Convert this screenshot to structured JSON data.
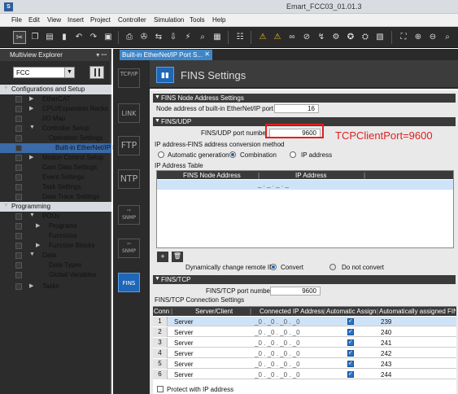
{
  "window": {
    "title": "Emart_FCC03_01.01.3"
  },
  "menu": [
    "File",
    "Edit",
    "View",
    "Insert",
    "Project",
    "Controller",
    "Simulation",
    "Tools",
    "Help"
  ],
  "sidebar": {
    "title": "Multiview Explorer",
    "pin": "▾ ꟷ",
    "device": "FCC",
    "items": [
      {
        "label": "Configurations and Setup",
        "toggle": "▼",
        "head": true
      },
      {
        "label": "EtherCAT",
        "toggle": "▶"
      },
      {
        "label": "CPU/Expansion Racks",
        "toggle": "▶"
      },
      {
        "label": "I/O Map",
        "toggle": ""
      },
      {
        "label": "Controller Setup",
        "toggle": "▼"
      },
      {
        "label": "Operation Settings",
        "toggle": ""
      },
      {
        "label": "Built-in EtherNet/IP P",
        "toggle": "",
        "selected": true
      },
      {
        "label": "Motion Control Setup",
        "toggle": "▶"
      },
      {
        "label": "Cam Data Settings",
        "toggle": ""
      },
      {
        "label": "Event Settings",
        "toggle": ""
      },
      {
        "label": "Task Settings",
        "toggle": ""
      },
      {
        "label": "Data Trace Settings",
        "toggle": ""
      },
      {
        "label": "Programming",
        "toggle": "▼",
        "head": true
      },
      {
        "label": "POUs",
        "toggle": "▼"
      },
      {
        "label": "Programs",
        "toggle": "▶"
      },
      {
        "label": "Functions",
        "toggle": ""
      },
      {
        "label": "Function Blocks",
        "toggle": "▶"
      },
      {
        "label": "Data",
        "toggle": "▼"
      },
      {
        "label": "Data Types",
        "toggle": ""
      },
      {
        "label": "Global Variables",
        "toggle": ""
      },
      {
        "label": "Tasks",
        "toggle": "▶"
      }
    ]
  },
  "tab": {
    "label": "Built-in EtherNet/IP Port S...",
    "close": "✕"
  },
  "protocols": [
    "TCP/IP",
    "LINK",
    "FTP",
    "NTP",
    "SNMP",
    "SNMP",
    "FINS"
  ],
  "content": {
    "heading": "FINS Settings",
    "fins_node": {
      "section": "FINS Node Address Settings",
      "node_label": "Node address of built-in EtherNet/IP port",
      "node_value": "16"
    },
    "fins_udp": {
      "section": "FINS/UDP",
      "port_label": "FINS/UDP port numbe",
      "port_value": "9600",
      "method_label": "IP address-FINS address conversion method",
      "options": [
        "Automatic generation",
        "Combination",
        "IP address"
      ],
      "selected_option": "Combination",
      "table_label": "IP Address Table",
      "table_headers": [
        "FINS Node Address",
        "IP Address"
      ],
      "table_row_ip": "_ . _ . _ . _",
      "add_button": "+",
      "delete_button": "🗑",
      "dyn_label": "Dynamically change remote IP",
      "dyn_options": [
        "Convert",
        "Do not convert"
      ],
      "dyn_selected": "Convert"
    },
    "fins_tcp": {
      "section": "FINS/TCP",
      "port_label": "FINS/TCP port number",
      "port_value": "9600",
      "conn_label": "FINS/TCP Connection Settings",
      "headers": [
        "Conn",
        "Server/Client",
        "Connected IP Address",
        "Automatic Assignr",
        "Automatically assigned FIN"
      ],
      "rows": [
        {
          "num": "1",
          "mode": "Server",
          "ip": "_0 . _0 . _0 . _0",
          "auto": true,
          "fins": "239"
        },
        {
          "num": "2",
          "mode": "Server",
          "ip": "_0 . _0 . _0 . _0",
          "auto": true,
          "fins": "240"
        },
        {
          "num": "3",
          "mode": "Server",
          "ip": "_0 . _0 . _0 . _0",
          "auto": true,
          "fins": "241"
        },
        {
          "num": "4",
          "mode": "Server",
          "ip": "_0 . _0 . _0 . _0",
          "auto": true,
          "fins": "242"
        },
        {
          "num": "5",
          "mode": "Server",
          "ip": "_0 . _0 . _0 . _0",
          "auto": true,
          "fins": "243"
        },
        {
          "num": "6",
          "mode": "Server",
          "ip": "_0 . _0 . _0 . _0",
          "auto": true,
          "fins": "244"
        }
      ],
      "protect_label": "Protect with IP address"
    },
    "annotation": "TCPClientPort=9600"
  },
  "colors": {
    "accent": "#1d66b8",
    "annotation": "#e02020"
  }
}
